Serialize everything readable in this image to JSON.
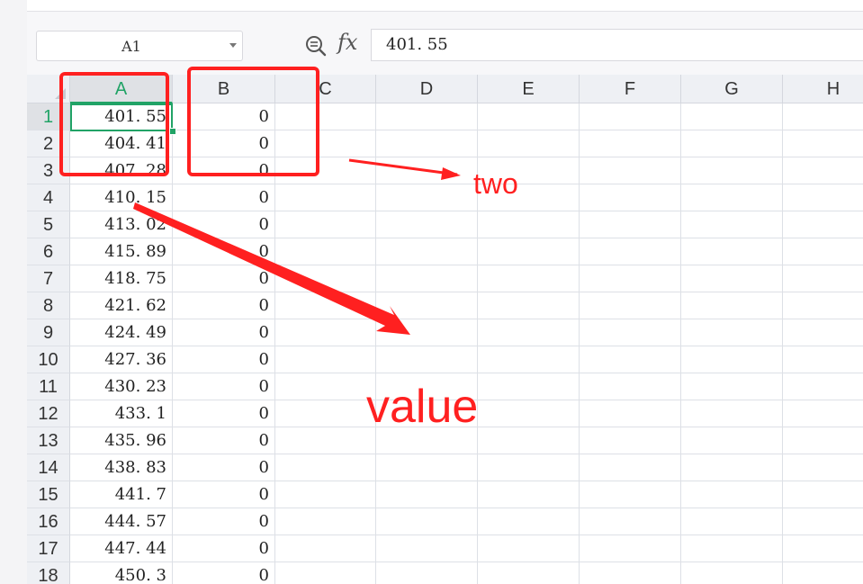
{
  "formula_bar": {
    "name_box": "A1",
    "zoom_icon": "zoom-icon",
    "fx_label": "fx",
    "formula": "401. 55"
  },
  "columns": [
    "A",
    "B",
    "C",
    "D",
    "E",
    "F",
    "G",
    "H"
  ],
  "selected_column": "A",
  "rows": [
    {
      "n": "1",
      "a": "401. 55",
      "b": "0"
    },
    {
      "n": "2",
      "a": "404. 41",
      "b": "0"
    },
    {
      "n": "3",
      "a": "407. 28",
      "b": "0"
    },
    {
      "n": "4",
      "a": "410. 15",
      "b": "0"
    },
    {
      "n": "5",
      "a": "413. 02",
      "b": "0"
    },
    {
      "n": "6",
      "a": "415. 89",
      "b": "0"
    },
    {
      "n": "7",
      "a": "418. 75",
      "b": "0"
    },
    {
      "n": "8",
      "a": "421. 62",
      "b": "0"
    },
    {
      "n": "9",
      "a": "424. 49",
      "b": "0"
    },
    {
      "n": "10",
      "a": "427. 36",
      "b": "0"
    },
    {
      "n": "11",
      "a": "430. 23",
      "b": "0"
    },
    {
      "n": "12",
      "a": "433. 1",
      "b": "0"
    },
    {
      "n": "13",
      "a": "435. 96",
      "b": "0"
    },
    {
      "n": "14",
      "a": "438. 83",
      "b": "0"
    },
    {
      "n": "15",
      "a": "441. 7",
      "b": "0"
    },
    {
      "n": "16",
      "a": "444. 57",
      "b": "0"
    },
    {
      "n": "17",
      "a": "447. 44",
      "b": "0"
    },
    {
      "n": "18",
      "a": "450. 3",
      "b": "0"
    }
  ],
  "annotations": {
    "two": "two",
    "value": "value",
    "color": "#ff2020"
  },
  "colors": {
    "accent": "#21a366",
    "annotation": "#ff2020"
  }
}
